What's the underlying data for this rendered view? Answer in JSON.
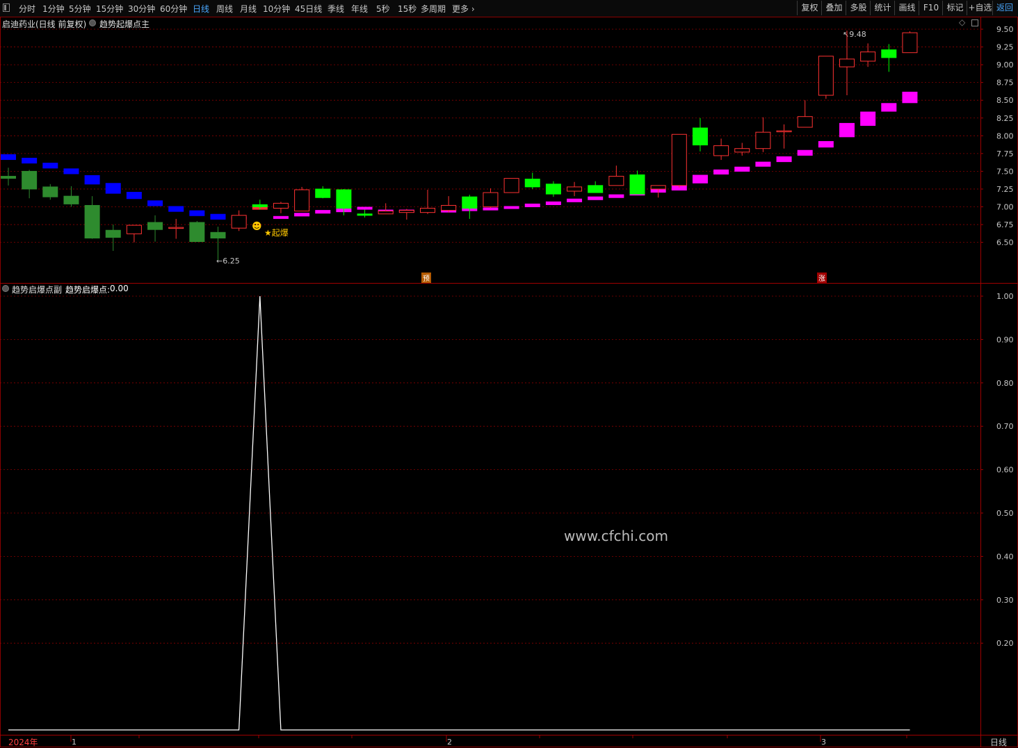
{
  "toolbar": {
    "periods": [
      "分时",
      "1分钟",
      "5分钟",
      "15分钟",
      "30分钟",
      "60分钟",
      "日线",
      "周线",
      "月线",
      "10分钟",
      "45日线",
      "季线",
      "年线",
      "5秒",
      "15秒",
      "多周期",
      "更多"
    ],
    "active_period": "日线",
    "more_chevron": "›",
    "right_buttons": [
      "复权",
      "叠加",
      "多股",
      "统计",
      "画线",
      "F10",
      "标记",
      "+自选",
      "返回"
    ],
    "active_right": "返回"
  },
  "main_panel": {
    "stock_title": "启迪药业(日线 前复权)",
    "indicator_name": "趋势起爆点主",
    "price_axis": [
      "9.50",
      "9.25",
      "9.00",
      "8.75",
      "8.50",
      "8.25",
      "8.00",
      "7.75",
      "7.50",
      "7.25",
      "7.00",
      "6.75",
      "6.50"
    ],
    "high_marker": "9.48",
    "low_marker": "6.25",
    "signal_label": "★起爆",
    "signal_emoji": "☻",
    "badge_yu": "预",
    "badge_zhang": "涨"
  },
  "sub_panel": {
    "indicator_name": "趋势启爆点副",
    "value_label": "趋势启爆点:",
    "value": "0.00",
    "axis": [
      "1.00",
      "0.90",
      "0.80",
      "0.70",
      "0.60",
      "0.50",
      "0.40",
      "0.30",
      "0.20"
    ],
    "watermark": "www.cfchi.com"
  },
  "date_axis": {
    "year": "2024年",
    "months": [
      "1",
      "2",
      "3"
    ],
    "period_label": "日线"
  },
  "colors": {
    "up": "#ff3232",
    "down": "#00ff00",
    "down_early": "#2e8b2e",
    "blue_line": "#0000ff",
    "magenta_line": "#ff00ff",
    "grid": "#8b0000",
    "axis_text": "#c8c8c8",
    "signal": "#ffc800"
  },
  "chart_data": [
    {
      "type": "candlestick",
      "title": "启迪药业(日线 前复权)",
      "fields": [
        "open",
        "high",
        "low",
        "close"
      ],
      "candles": [
        [
          7.43,
          7.55,
          7.3,
          7.4
        ],
        [
          7.5,
          7.52,
          7.12,
          7.25
        ],
        [
          7.28,
          7.32,
          7.1,
          7.14
        ],
        [
          7.15,
          7.29,
          7.0,
          7.04
        ],
        [
          7.02,
          7.15,
          6.55,
          6.56
        ],
        [
          6.67,
          6.75,
          6.38,
          6.57
        ],
        [
          6.62,
          6.74,
          6.5,
          6.74
        ],
        [
          6.78,
          6.88,
          6.51,
          6.68
        ],
        [
          6.7,
          6.83,
          6.55,
          6.71
        ],
        [
          6.78,
          6.8,
          6.51,
          6.51
        ],
        [
          6.64,
          6.72,
          6.25,
          6.56
        ],
        [
          6.7,
          6.95,
          6.66,
          6.88
        ],
        [
          7.03,
          7.1,
          6.96,
          7.0
        ],
        [
          6.98,
          7.07,
          6.91,
          7.05
        ],
        [
          6.94,
          7.28,
          6.94,
          7.24
        ],
        [
          7.25,
          7.29,
          7.12,
          7.13
        ],
        [
          7.24,
          7.25,
          6.88,
          6.98
        ],
        [
          6.9,
          6.96,
          6.85,
          6.88
        ],
        [
          6.9,
          7.05,
          6.9,
          6.94
        ],
        [
          6.92,
          6.97,
          6.82,
          6.95
        ],
        [
          6.92,
          7.24,
          6.9,
          6.98
        ],
        [
          6.95,
          7.15,
          6.92,
          7.02
        ],
        [
          7.14,
          7.17,
          6.83,
          6.98
        ],
        [
          7.0,
          7.26,
          6.98,
          7.2
        ],
        [
          7.2,
          7.22,
          7.2,
          7.4
        ],
        [
          7.39,
          7.48,
          7.25,
          7.28
        ],
        [
          7.32,
          7.36,
          7.14,
          7.18
        ],
        [
          7.22,
          7.35,
          7.15,
          7.28
        ],
        [
          7.3,
          7.36,
          7.2,
          7.2
        ],
        [
          7.3,
          7.58,
          7.3,
          7.43
        ],
        [
          7.45,
          7.51,
          7.18,
          7.18
        ],
        [
          7.25,
          7.3,
          7.13,
          7.3
        ],
        [
          7.3,
          8.02,
          7.27,
          8.02
        ],
        [
          8.11,
          8.25,
          7.78,
          7.87
        ],
        [
          7.72,
          7.96,
          7.66,
          7.86
        ],
        [
          7.77,
          7.9,
          7.72,
          7.82
        ],
        [
          7.82,
          8.26,
          7.77,
          8.05
        ],
        [
          8.07,
          8.16,
          7.82,
          8.07
        ],
        [
          8.12,
          8.5,
          8.12,
          8.27
        ],
        [
          8.57,
          9.12,
          8.52,
          9.12
        ],
        [
          8.97,
          9.48,
          8.57,
          9.08
        ],
        [
          9.05,
          9.3,
          8.97,
          9.18
        ],
        [
          9.21,
          9.29,
          8.9,
          9.1
        ],
        [
          9.17,
          9.47,
          9.17,
          9.45
        ]
      ],
      "band": {
        "blue_upto_index": 10,
        "red_index": 12,
        "values": [
          7.7,
          7.65,
          7.58,
          7.5,
          7.38,
          7.26,
          7.16,
          7.05,
          6.97,
          6.91,
          6.86,
          6.84,
          6.99,
          6.85,
          6.89,
          6.93,
          6.95,
          6.98,
          6.94,
          6.94,
          6.94,
          6.94,
          6.96,
          6.97,
          6.99,
          7.02,
          7.05,
          7.09,
          7.12,
          7.15,
          7.19,
          7.23,
          7.28,
          7.39,
          7.49,
          7.53,
          7.6,
          7.67,
          7.76,
          7.88,
          8.08,
          8.24,
          8.4,
          8.54
        ],
        "thickness": [
          0.08,
          0.08,
          0.08,
          0.08,
          0.13,
          0.15,
          0.1,
          0.08,
          0.08,
          0.08,
          0.08,
          0.04,
          0.06,
          0.04,
          0.05,
          0.05,
          0.05,
          0.04,
          0.04,
          0.04,
          0.04,
          0.04,
          0.04,
          0.04,
          0.04,
          0.05,
          0.05,
          0.05,
          0.05,
          0.05,
          0.06,
          0.06,
          0.1,
          0.12,
          0.07,
          0.07,
          0.07,
          0.08,
          0.08,
          0.09,
          0.2,
          0.2,
          0.12,
          0.16
        ]
      },
      "ylim": [
        6.2,
        9.6
      ]
    },
    {
      "type": "line",
      "title": "趋势启爆点副",
      "values": [
        0,
        0,
        0,
        0,
        0,
        0,
        0,
        0,
        0,
        0,
        0,
        0,
        1,
        0,
        0,
        0,
        0,
        0,
        0,
        0,
        0,
        0,
        0,
        0,
        0,
        0,
        0,
        0,
        0,
        0,
        0,
        0,
        0,
        0,
        0,
        0,
        0,
        0,
        0,
        0,
        0,
        0,
        0,
        0
      ],
      "ylim": [
        0.0,
        1.03
      ]
    }
  ]
}
